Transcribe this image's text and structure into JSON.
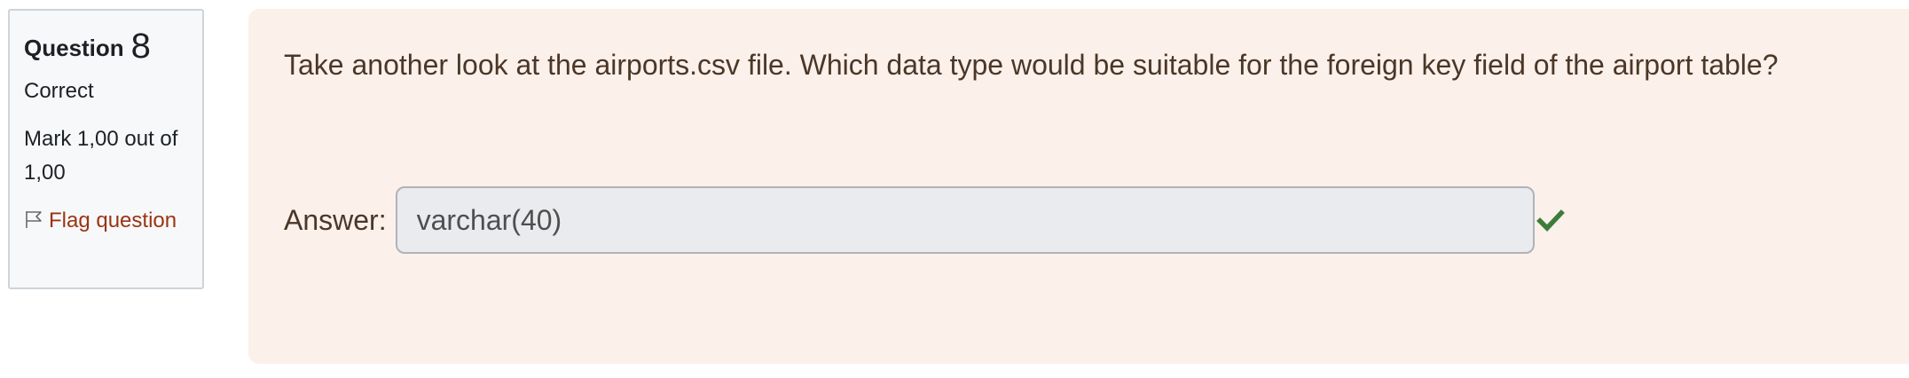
{
  "info": {
    "question_label": "Question",
    "question_number": "8",
    "state": "Correct",
    "grade": "Mark 1,00 out of 1,00",
    "flag_label": "Flag question"
  },
  "question": {
    "text": "Take another look at the airports.csv file. Which data type would be suitable for the foreign key field of the airport table?",
    "answer_label": "Answer:",
    "answer_value": "varchar(40)"
  },
  "colors": {
    "panel_bg": "#fcf0ea",
    "info_bg": "#f7f8fa",
    "flag_link": "#9a3412",
    "check": "#3d7d3c"
  },
  "icons": {
    "flag": "flag-icon",
    "correct": "check-icon"
  }
}
